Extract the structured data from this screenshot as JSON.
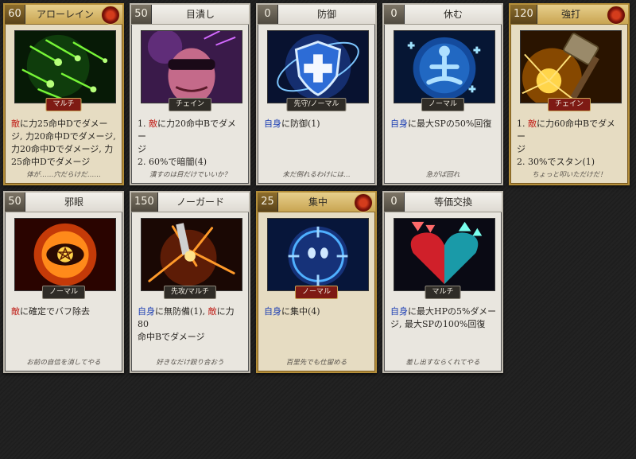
{
  "cards": [
    {
      "cost": "60",
      "name": "アローレイン",
      "gold": true,
      "emblem": true,
      "tag": "マルチ",
      "tag_red": true,
      "art": "green-arrows-art",
      "desc": [
        [
          [
            "e",
            "敵"
          ],
          [
            "n",
            "に力25命中Dでダメー"
          ]
        ],
        [
          [
            "n",
            "ジ, 力20命中Dでダメージ,"
          ]
        ],
        [
          [
            "n",
            "力20命中Dでダメージ, 力"
          ]
        ],
        [
          [
            "n",
            "25命中Dでダメージ"
          ]
        ]
      ],
      "flavor": "体が……穴だらけだ……"
    },
    {
      "cost": "50",
      "name": "目潰し",
      "gold": false,
      "emblem": false,
      "tag": "チェイン",
      "tag_red": false,
      "art": "blinded-face-art",
      "desc": [
        [
          [
            "n",
            "1. "
          ],
          [
            "e",
            "敵"
          ],
          [
            "n",
            "に力20命中Bでダメー"
          ]
        ],
        [
          [
            "n",
            "ジ"
          ]
        ],
        [
          [
            "n",
            "2. 60%で暗闇(4)"
          ]
        ]
      ],
      "flavor": "潰すのは目だけでいいか？"
    },
    {
      "cost": "0",
      "name": "防御",
      "gold": false,
      "emblem": false,
      "tag": "先守/ノーマル",
      "tag_red": false,
      "art": "shield-cross-art",
      "desc": [
        [
          [
            "s",
            "自身"
          ],
          [
            "n",
            "に防御(1)"
          ]
        ]
      ],
      "flavor": "未だ倒れるわけには…"
    },
    {
      "cost": "0",
      "name": "休む",
      "gold": false,
      "emblem": false,
      "tag": "ノーマル",
      "tag_red": false,
      "art": "meditation-art",
      "desc": [
        [
          [
            "s",
            "自身"
          ],
          [
            "n",
            "に最大SPの50%回復"
          ]
        ]
      ],
      "flavor": "急がば回れ"
    },
    {
      "cost": "120",
      "name": "強打",
      "gold": true,
      "emblem": true,
      "tag": "チェイン",
      "tag_red": true,
      "art": "hammer-strike-art",
      "desc": [
        [
          [
            "n",
            "1. "
          ],
          [
            "e",
            "敵"
          ],
          [
            "n",
            "に力60命中Bでダメー"
          ]
        ],
        [
          [
            "n",
            "ジ"
          ]
        ],
        [
          [
            "n",
            "2. 30%でスタン(1)"
          ]
        ]
      ],
      "flavor": "ちょっと叩いただけだ！"
    },
    {
      "cost": "50",
      "name": "邪眼",
      "gold": false,
      "emblem": false,
      "tag": "ノーマル",
      "tag_red": false,
      "art": "evil-eye-art",
      "desc": [
        [
          [
            "e",
            "敵"
          ],
          [
            "n",
            "に確定でバフ除去"
          ]
        ]
      ],
      "flavor": "お前の自信を消してやる"
    },
    {
      "cost": "150",
      "name": "ノーガード",
      "gold": false,
      "emblem": false,
      "tag": "先攻/マルチ",
      "tag_red": false,
      "art": "no-guard-art",
      "desc": [
        [
          [
            "s",
            "自身"
          ],
          [
            "n",
            "に無防備(1), "
          ],
          [
            "e",
            "敵"
          ],
          [
            "n",
            "に力80"
          ]
        ],
        [
          [
            "n",
            "命中Bでダメージ"
          ]
        ]
      ],
      "flavor": "好きなだけ殴り合おう"
    },
    {
      "cost": "25",
      "name": "集中",
      "gold": true,
      "emblem": true,
      "tag": "ノーマル",
      "tag_red": true,
      "art": "focus-target-art",
      "desc": [
        [
          [
            "s",
            "自身"
          ],
          [
            "n",
            "に集中(4)"
          ]
        ]
      ],
      "flavor": "百里先でも仕留める"
    },
    {
      "cost": "0",
      "name": "等価交換",
      "gold": false,
      "emblem": false,
      "tag": "マルチ",
      "tag_red": false,
      "art": "exchange-heart-art",
      "desc": [
        [
          [
            "s",
            "自身"
          ],
          [
            "n",
            "に最大HPの5%ダメー"
          ]
        ],
        [
          [
            "n",
            "ジ, 最大SPの100%回復"
          ]
        ]
      ],
      "flavor": "差し出すならくれてやる"
    }
  ]
}
